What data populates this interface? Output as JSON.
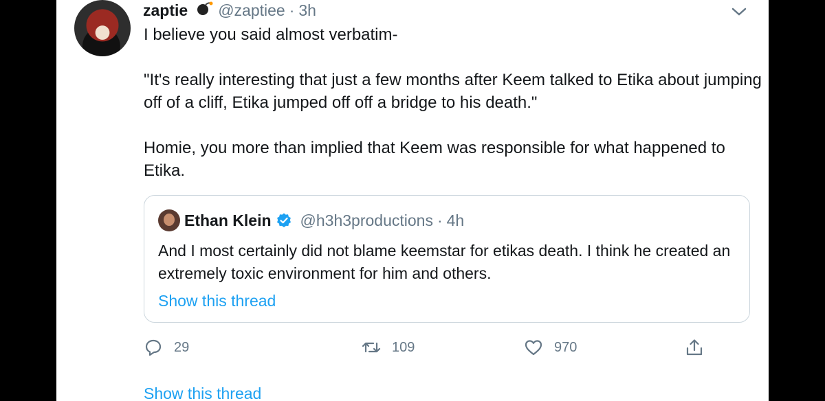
{
  "tweet": {
    "name": "zaptie",
    "handle": "@zaptiee",
    "separator": "·",
    "time": "3h",
    "text": "I believe you said almost verbatim-\n\n\"It's really interesting that just a few months after Keem talked to Etika about jumping off of a cliff, Etika jumped off off a bridge to his death.\"\n\nHomie, you more than implied that Keem was responsible for what happened to Etika."
  },
  "quote": {
    "name": "Ethan Klein",
    "handle": "@h3h3productions",
    "separator": "·",
    "time": "4h",
    "text": "And I most certainly did not blame keemstar for etikas death. I think he created an extremely toxic environment for him and others.",
    "link": "Show this thread"
  },
  "actions": {
    "replies": "29",
    "retweets": "109",
    "likes": "970"
  },
  "footer_link": "Show this thread",
  "colors": {
    "accent": "#1da1f2",
    "muted": "#657786",
    "text": "#14171a"
  }
}
